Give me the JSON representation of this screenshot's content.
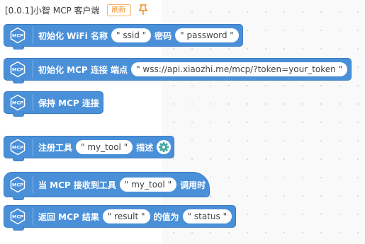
{
  "header": {
    "title": "[0.0.1]小智 MCP 客户端",
    "refresh_label": "刷新",
    "pin_icon": "pin-icon"
  },
  "colors": {
    "block": "#4a90d9",
    "accent": "#f08c1d"
  },
  "blocks": [
    {
      "id": "init-wifi",
      "text1": "初始化 WiFi 名称",
      "field1": "\" ssid \"",
      "text2": "密码",
      "field2": "\" password \""
    },
    {
      "id": "init-mcp-endpoint",
      "text1": "初始化 MCP 连接 端点",
      "field1": "\" wss://api.xiaozhi.me/mcp/?token=your_token \""
    },
    {
      "id": "keep-mcp-connection",
      "text1": "保持 MCP 连接"
    },
    {
      "id": "register-tool",
      "text1": "注册工具",
      "field1": "\" my_tool \"",
      "text2": "描述",
      "icon": "gear-icon"
    },
    {
      "id": "on-tool-called",
      "text1": "当 MCP 接收到工具",
      "field1": "\" my_tool \"",
      "text2": "调用时"
    },
    {
      "id": "return-mcp-result",
      "text1": "返回 MCP 结果",
      "field1": "\" result \"",
      "text2": "的值为",
      "field2": "\" status \""
    }
  ]
}
